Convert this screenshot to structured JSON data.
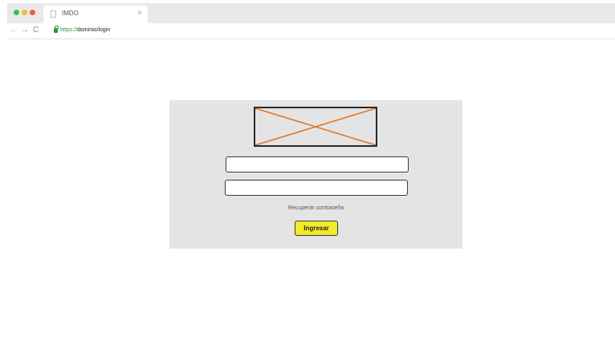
{
  "browser": {
    "tab": {
      "title": "IMDO",
      "close_glyph": "×",
      "icon": "document-icon"
    },
    "nav": {
      "back_glyph": "←",
      "forward_glyph": "→",
      "reload_glyph": "C"
    },
    "address": {
      "scheme": "https://",
      "path": "dominio/login",
      "icon": "lock-icon"
    }
  },
  "login": {
    "logo_icon": "image-placeholder-icon",
    "username_value": "",
    "password_value": "",
    "recover_link": "Recuperar contraseña",
    "submit_label": "Ingresar"
  },
  "colors": {
    "panel_bg": "#e4e4e5",
    "placeholder_cross": "#e07a2c",
    "submit_bg": "#f2eb2a",
    "secure_green": "#2b9a3b"
  }
}
